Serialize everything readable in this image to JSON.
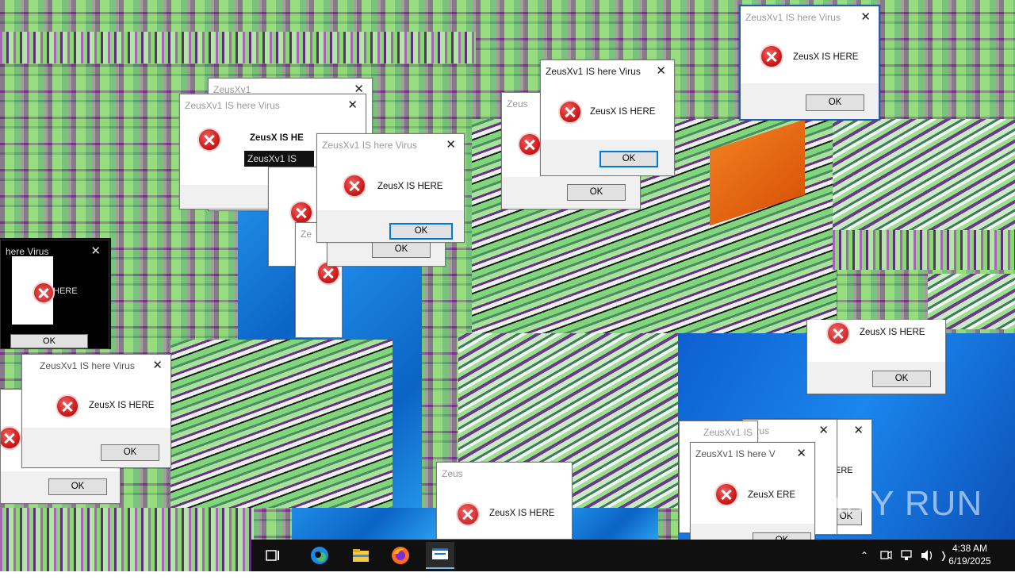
{
  "dialog": {
    "title": "ZeusXv1 IS here Virus",
    "message": "ZeusX IS HERE",
    "ok_label": "OK"
  },
  "fragments": {
    "title_cut_1": "ZeusXv1 IS here V",
    "title_cut_2": "here  Virus",
    "title_cut_3": "ZeusXv1 IS",
    "title_cut_4": "Virus",
    "title_cut_5": "Ze",
    "title_cut_6": "Zeus",
    "title_cut_7": "ZeusXv1",
    "message_cut_1": "ZeusX IS HE",
    "message_cut_2": "HERE",
    "message_cut_3": "ZeusX ERE",
    "message_cut_4": "ERE",
    "message_cut_5": "ZeusX IS HERE",
    "ok_cut": "OK"
  },
  "taskbar": {
    "apps": [
      "task-view-icon",
      "edge-icon",
      "file-explorer-icon",
      "firefox-icon",
      "virus-app-icon"
    ],
    "time": "4:38 AM",
    "date": "6/19/2025"
  },
  "watermark": "ANY RUN",
  "colors": {
    "error_red": "#d01b1b",
    "accent_blue": "#0078d7",
    "taskbar": "#101010"
  }
}
